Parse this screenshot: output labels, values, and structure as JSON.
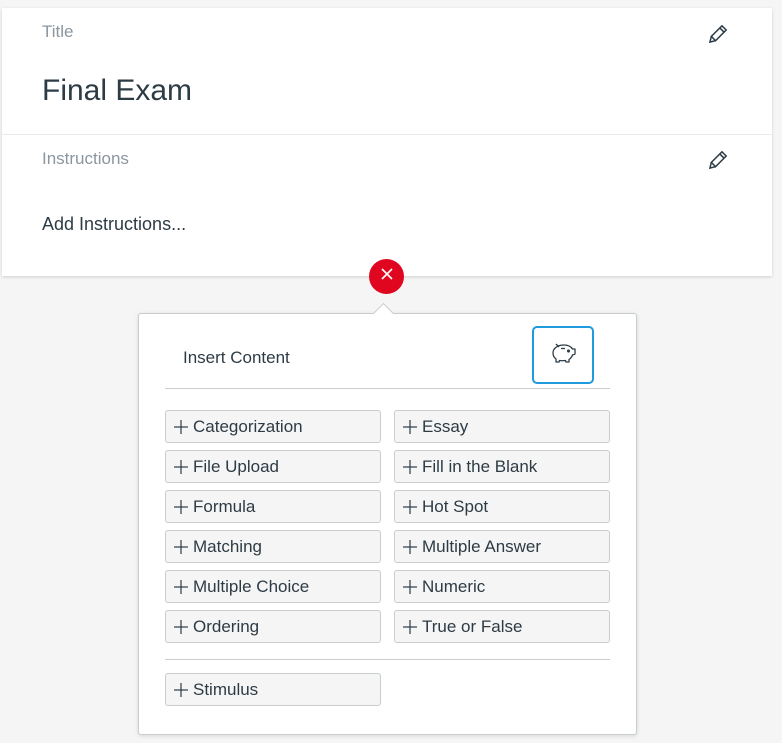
{
  "title_section": {
    "label": "Title",
    "value": "Final Exam"
  },
  "instructions_section": {
    "label": "Instructions",
    "placeholder": "Add Instructions..."
  },
  "insert_panel": {
    "heading": "Insert Content",
    "question_types": [
      "Categorization",
      "Essay",
      "File Upload",
      "Fill in the Blank",
      "Formula",
      "Hot Spot",
      "Matching",
      "Multiple Answer",
      "Multiple Choice",
      "Numeric",
      "Ordering",
      "True or False"
    ],
    "stimulus_label": "Stimulus"
  },
  "icons": {
    "edit": "pencil-icon",
    "close": "close-icon",
    "item_bank": "piggy-bank-icon",
    "add": "plus-icon"
  },
  "colors": {
    "close": "#e0061f",
    "focus": "#1f9bde",
    "text": "#2d3b45",
    "muted": "#8b969e"
  }
}
